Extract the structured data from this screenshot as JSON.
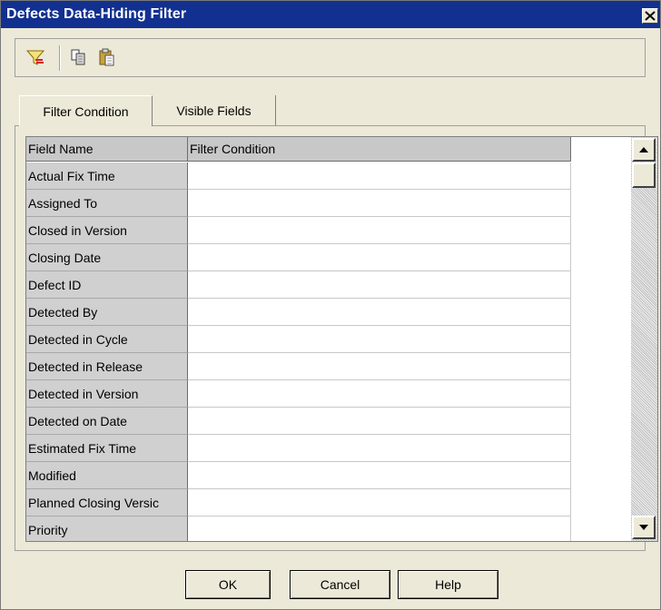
{
  "window": {
    "title": "Defects Data-Hiding Filter"
  },
  "toolbar": {
    "icons": [
      "filter-icon",
      "copy-icon",
      "paste-icon"
    ]
  },
  "tabs": [
    {
      "label": "Filter Condition",
      "active": true
    },
    {
      "label": "Visible Fields",
      "active": false
    }
  ],
  "grid": {
    "columns": [
      "Field Name",
      "Filter Condition"
    ],
    "rows": [
      "Actual Fix Time",
      "Assigned To",
      "Closed in Version",
      "Closing Date",
      "Defect ID",
      "Detected By",
      "Detected in Cycle",
      "Detected in Release",
      "Detected in Version",
      "Detected on Date",
      "Estimated Fix Time",
      "Modified",
      "Planned Closing Versic",
      "Priority"
    ]
  },
  "buttons": {
    "ok": "OK",
    "cancel": "Cancel",
    "help": "Help"
  }
}
